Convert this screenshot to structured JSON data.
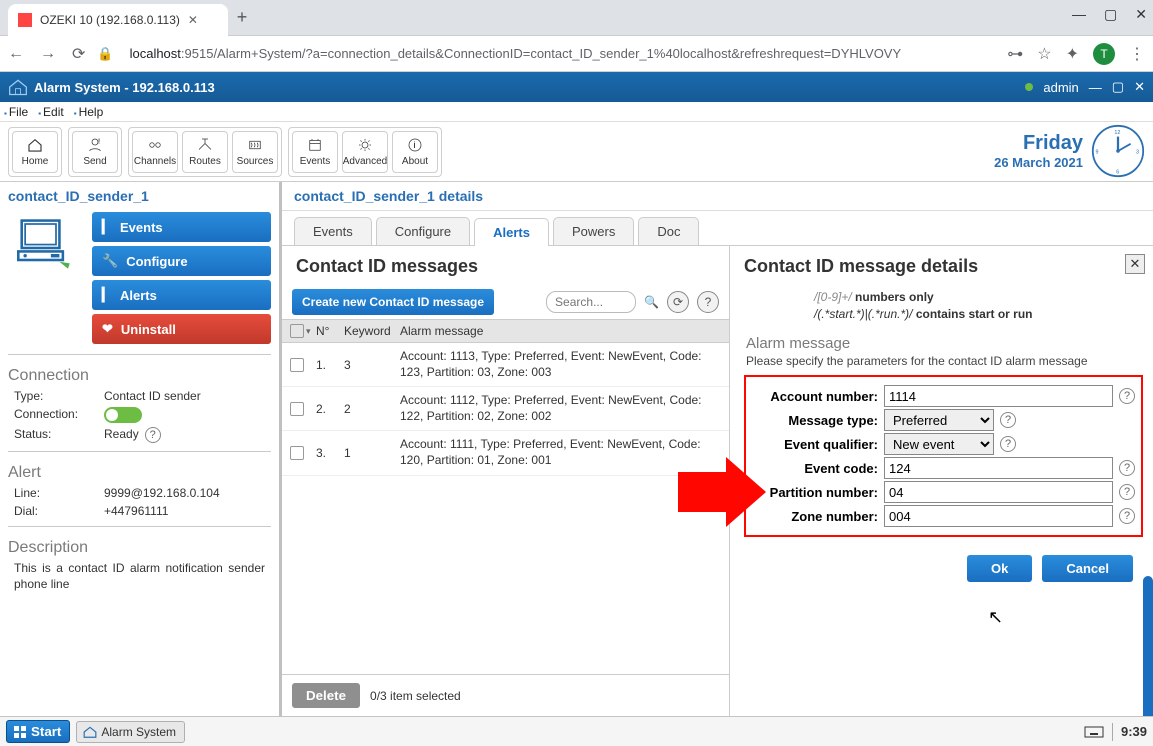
{
  "browser": {
    "tab_title": "OZEKI 10 (192.168.0.113)",
    "url_host": "localhost",
    "url_path": ":9515/Alarm+System/?a=connection_details&ConnectionID=contact_ID_sender_1%40localhost&refreshrequest=DYHLVOVY",
    "avatar_letter": "T"
  },
  "app": {
    "title": "Alarm System - 192.168.0.113",
    "user": "admin"
  },
  "menubar": [
    "File",
    "Edit",
    "Help"
  ],
  "toolbar": {
    "items": [
      "Home",
      "Send",
      "Channels",
      "Routes",
      "Sources",
      "Events",
      "Advanced",
      "About"
    ]
  },
  "datebox": {
    "day": "Friday",
    "date": "26 March 2021"
  },
  "sidebar": {
    "title": "contact_ID_sender_1",
    "buttons": {
      "events": "Events",
      "configure": "Configure",
      "alerts": "Alerts",
      "uninstall": "Uninstall"
    },
    "connection_h": "Connection",
    "rows": {
      "type_k": "Type:",
      "type_v": "Contact ID sender",
      "conn_k": "Connection:",
      "status_k": "Status:",
      "status_v": "Ready"
    },
    "alert_h": "Alert",
    "alert_rows": {
      "line_k": "Line:",
      "line_v": "9999@192.168.0.104",
      "dial_k": "Dial:",
      "dial_v": "+447961111"
    },
    "desc_h": "Description",
    "desc_body": "This is a contact ID alarm notification sender phone line"
  },
  "content_header": "contact_ID_sender_1 details",
  "tabs": [
    "Events",
    "Configure",
    "Alerts",
    "Powers",
    "Doc"
  ],
  "active_tab": 2,
  "left_pane": {
    "title": "Contact ID messages",
    "create_label": "Create new Contact ID message",
    "search_placeholder": "Search...",
    "columns": {
      "n": "N°",
      "kw": "Keyword",
      "msg": "Alarm message"
    },
    "rows": [
      {
        "n": "1.",
        "kw": "3",
        "msg": "Account: 1113, Type: Preferred, Event: NewEvent, Code: 123, Partition: 03, Zone: 003"
      },
      {
        "n": "2.",
        "kw": "2",
        "msg": "Account: 1112, Type: Preferred, Event: NewEvent, Code: 122, Partition: 02, Zone: 002"
      },
      {
        "n": "3.",
        "kw": "1",
        "msg": "Account: 1111, Type: Preferred, Event: NewEvent, Code: 120, Partition: 01, Zone: 001"
      }
    ],
    "delete_label": "Delete",
    "status_text": "0/3 item selected"
  },
  "right_pane": {
    "title": "Contact ID message details",
    "regex_line1": "/[0-9]+/ numbers only",
    "regex_line2": "/(.*start.*)|(.*run.*)/ contains start or run",
    "fieldset_title": "Alarm message",
    "fieldset_note": "Please specify the parameters for the contact ID alarm message",
    "form": {
      "account_label": "Account number:",
      "account_value": "1114",
      "msgtype_label": "Message type:",
      "msgtype_value": "Preferred",
      "eventq_label": "Event qualifier:",
      "eventq_value": "New event",
      "eventcode_label": "Event code:",
      "eventcode_value": "124",
      "partition_label": "Partition number:",
      "partition_value": "04",
      "zone_label": "Zone number:",
      "zone_value": "004"
    },
    "ok_label": "Ok",
    "cancel_label": "Cancel"
  },
  "bottom": {
    "start": "Start",
    "task": "Alarm System",
    "clock": "9:39"
  }
}
